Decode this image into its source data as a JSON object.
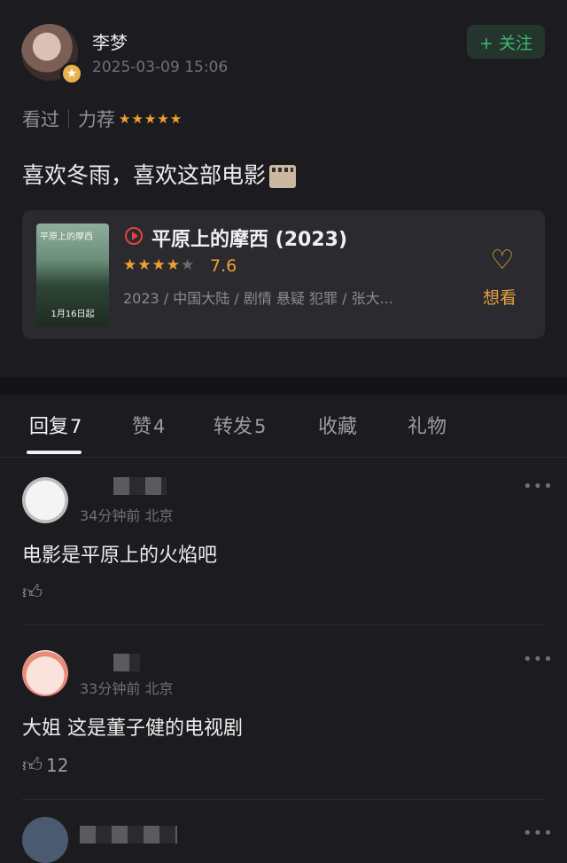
{
  "post": {
    "username": "李梦",
    "timestamp": "2025-03-09 15:06",
    "follow_label": "+ 关注",
    "status": "看过",
    "recommend": "力荐",
    "stars": "★★★★★",
    "rating_value": 5,
    "text": "喜欢冬雨，喜欢这部电影",
    "avatar_badge_icon": "star-badge-icon"
  },
  "movie": {
    "title": "平原上的摩西 (2023)",
    "poster_title": "平原上的摩西",
    "poster_date": "1月16日起",
    "stars_full": "★★★★",
    "stars_empty": "★",
    "rating_value": 4,
    "score": "7.6",
    "meta": "2023 / 中国大陆 / 剧情 悬疑 犯罪 / 张大...",
    "want_label": "想看",
    "accent": "#e8a040"
  },
  "tabs": [
    {
      "label": "回复",
      "count": "7"
    },
    {
      "label": "赞",
      "count": "4"
    },
    {
      "label": "转发",
      "count": "5"
    },
    {
      "label": "收藏",
      "count": ""
    },
    {
      "label": "礼物",
      "count": ""
    }
  ],
  "comments": [
    {
      "time_location": "34分钟前 北京",
      "text": "电影是平原上的火焰吧",
      "likes": ""
    },
    {
      "time_location": "33分钟前 北京",
      "text": "大姐 这是董子健的电视剧",
      "likes": "12"
    }
  ],
  "colors": {
    "background": "#1c1c20",
    "card": "#2a2a2f",
    "follow_green": "#3dba6f",
    "star_orange": "#f0a030",
    "play_red": "#e0463e"
  }
}
